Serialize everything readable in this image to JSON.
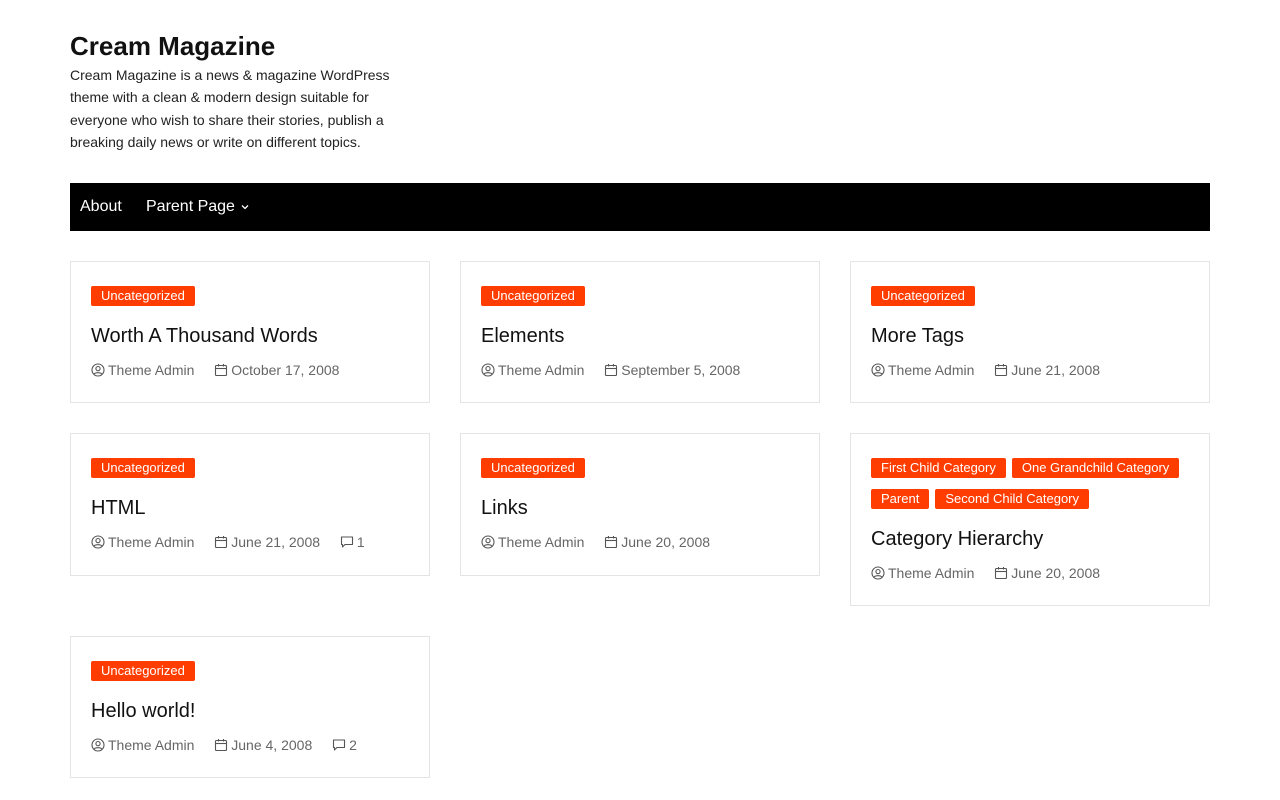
{
  "site": {
    "title": "Cream Magazine",
    "description": "Cream Magazine is a news & magazine WordPress theme with a clean & modern design suitable for everyone who wish to share their stories, publish a breaking daily news or write on different topics."
  },
  "nav": {
    "items": [
      {
        "label": "About"
      },
      {
        "label": "Parent Page"
      }
    ]
  },
  "colors": {
    "accent": "#ff3d00",
    "nav_bg": "#000000"
  },
  "posts": [
    {
      "categories": [
        "Uncategorized"
      ],
      "title": "Worth A Thousand Words",
      "author": "Theme Admin",
      "date": "October 17, 2008",
      "comments": null
    },
    {
      "categories": [
        "Uncategorized"
      ],
      "title": "Elements",
      "author": "Theme Admin",
      "date": "September 5, 2008",
      "comments": null
    },
    {
      "categories": [
        "Uncategorized"
      ],
      "title": "More Tags",
      "author": "Theme Admin",
      "date": "June 21, 2008",
      "comments": null
    },
    {
      "categories": [
        "Uncategorized"
      ],
      "title": "HTML",
      "author": "Theme Admin",
      "date": "June 21, 2008",
      "comments": "1"
    },
    {
      "categories": [
        "Uncategorized"
      ],
      "title": "Links",
      "author": "Theme Admin",
      "date": "June 20, 2008",
      "comments": null
    },
    {
      "categories": [
        "First Child Category",
        "One Grandchild Category",
        "Parent",
        "Second Child Category"
      ],
      "title": "Category Hierarchy",
      "author": "Theme Admin",
      "date": "June 20, 2008",
      "comments": null
    },
    {
      "categories": [
        "Uncategorized"
      ],
      "title": "Hello world!",
      "author": "Theme Admin",
      "date": "June 4, 2008",
      "comments": "2"
    }
  ]
}
